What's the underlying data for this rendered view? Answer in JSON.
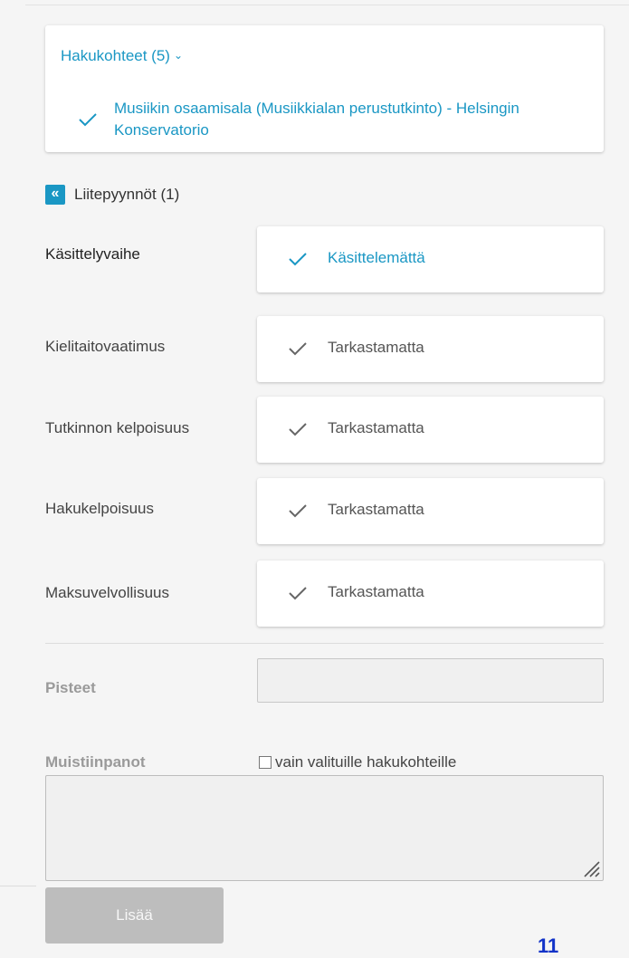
{
  "hakukohteet": {
    "title": "Hakukohteet (5)",
    "chevron": "⌄",
    "item": "Musiikin osaamisala (Musiikkialan perustutkinto) - Helsingin Konservatorio"
  },
  "liitepyynnot": {
    "button_glyph": "«",
    "label": "Liitepyynnöt (1)"
  },
  "states": [
    {
      "label": "Käsittelyvaihe",
      "value": "Käsittelemättä",
      "active": true
    },
    {
      "label": "Kielitaitovaatimus",
      "value": "Tarkastamatta",
      "active": false
    },
    {
      "label": "Tutkinnon kelpoisuus",
      "value": "Tarkastamatta",
      "active": false
    },
    {
      "label": "Hakukelpoisuus",
      "value": "Tarkastamatta",
      "active": false
    },
    {
      "label": "Maksuvelvollisuus",
      "value": "Tarkastamatta",
      "active": false
    }
  ],
  "pisteet": {
    "label": "Pisteet",
    "value": ""
  },
  "muistiinpanot": {
    "label": "Muistiinpanot",
    "checkbox_label": "vain valituille hakukohteille",
    "checked": false,
    "value": ""
  },
  "add_button": "Lisää",
  "page_number": "11",
  "colors": {
    "accent": "#1a97c4",
    "check_grey": "#666666",
    "button_disabled": "#bdbdbd"
  },
  "icons": {
    "check": "check-icon",
    "collapse": "double-chevron-left-icon",
    "resize": "resize-handle-icon"
  }
}
